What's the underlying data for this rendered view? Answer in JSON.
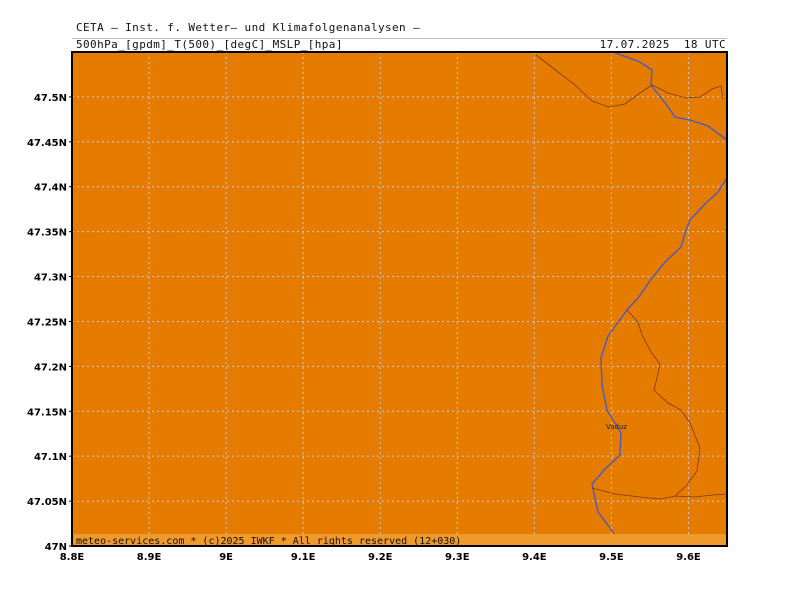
{
  "header": {
    "title": "CETA — Inst. f. Wetter— und Klimafolgenanalysen —",
    "parameters": "500hPa_[gpdm]_T(500)_[degC]_MSLP_[hpa]",
    "valid_time": "17.07.2025  18 UTC"
  },
  "footer": {
    "copyright": "meteo-services.com * (c)2025 IWKF * All rights reserved (12+030)"
  },
  "map": {
    "fill_color": "#e57c00",
    "footer_strip_color": "#f19a2c",
    "grid_color": "#c9c9c9",
    "country_border_color": "#4a5bbf",
    "admin_border_color": "#7a3a12",
    "lon_range": [
      8.8,
      9.65
    ],
    "lat_range": [
      47.0,
      47.55
    ],
    "lon_ticks": [
      "8.8E",
      "8.9E",
      "9E",
      "9.1E",
      "9.2E",
      "9.3E",
      "9.4E",
      "9.5E",
      "9.6E"
    ],
    "lat_ticks": [
      "47N",
      "47.05N",
      "47.1N",
      "47.15N",
      "47.2N",
      "47.25N",
      "47.3N",
      "47.35N",
      "47.4N",
      "47.45N",
      "47.5N"
    ],
    "place_label": "Vaduz"
  }
}
